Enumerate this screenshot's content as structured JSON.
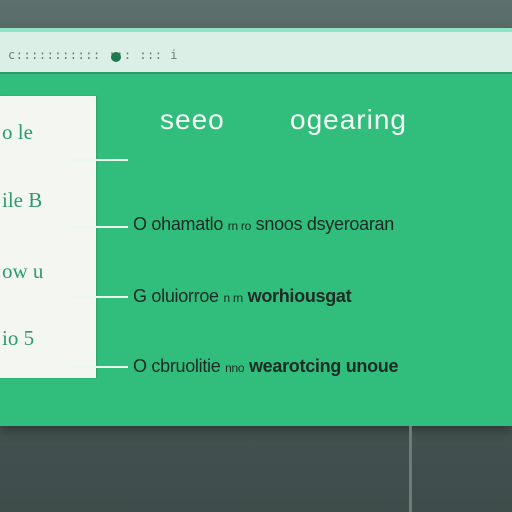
{
  "titlebar": {
    "address": "c::::::::::: ::: ::: i"
  },
  "left_panel": {
    "labels": [
      "o le",
      "ile B",
      "ow u",
      "io 5"
    ]
  },
  "header": {
    "left": "seeo",
    "right": "ogearing"
  },
  "rows": [
    {
      "prefix": "O",
      "text": "ohamatlo",
      "small": "rn ro",
      "tail": "snoos dsyeroaran"
    },
    {
      "prefix": "G",
      "text": "oluiorroe",
      "small": "n rn",
      "tail": "worhiousgat"
    },
    {
      "prefix": "O",
      "text": "cbruolitie",
      "small": "nno",
      "tail": "wearotcing unoue"
    }
  ],
  "colors": {
    "accent": "#31bd7c",
    "panel": "#f4f6f2",
    "titlebar": "#dcefe6"
  }
}
